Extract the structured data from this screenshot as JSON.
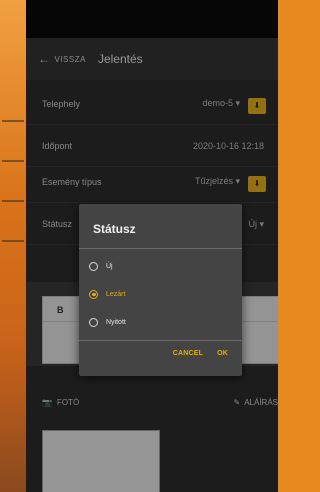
{
  "colors": {
    "accent": "#e2ad1c",
    "bg": "#2b2b2b",
    "appbar": "#333333"
  },
  "appbar": {
    "back_label": "VISSZA",
    "title": "Jelentés"
  },
  "form": {
    "telephely": {
      "label": "Telephely",
      "value": "demo-5"
    },
    "idopont": {
      "label": "Időpont",
      "value": "2020-10-16 12:18"
    },
    "esemeny": {
      "label": "Esemény típus",
      "value": "Tűzjelzés"
    },
    "statusz": {
      "label": "Státusz",
      "value": "Új"
    }
  },
  "editor": {
    "bold_button": "B"
  },
  "attachments": {
    "photo_label": "FOTÓ",
    "signature_label": "ALÁÍRÁS"
  },
  "dialog": {
    "title": "Státusz",
    "options": [
      {
        "label": "Új",
        "selected": false
      },
      {
        "label": "Lezárt",
        "selected": true
      },
      {
        "label": "Nyitott",
        "selected": false
      }
    ],
    "cancel_label": "CANCEL",
    "ok_label": "OK"
  }
}
